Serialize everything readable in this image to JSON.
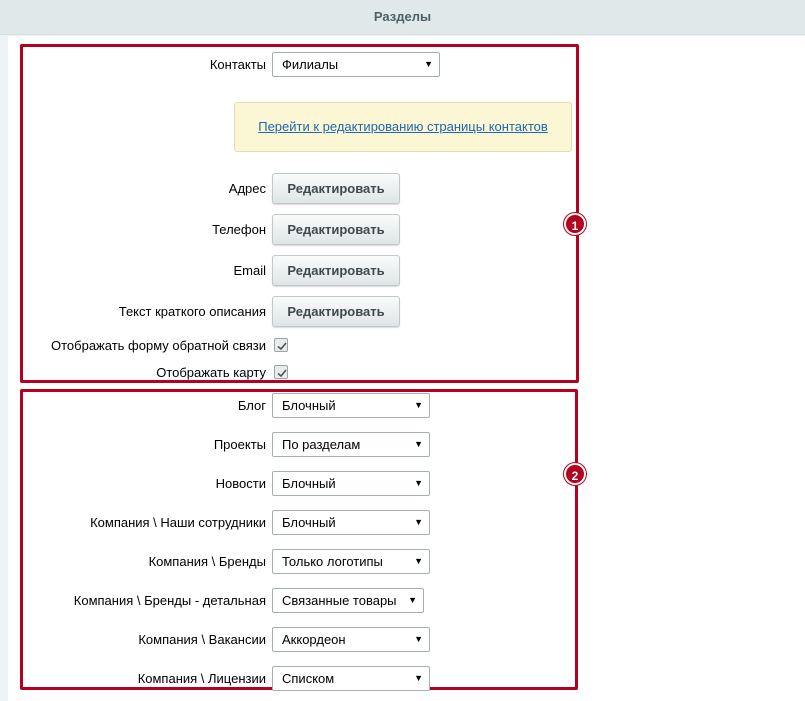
{
  "header": {
    "title": "Разделы"
  },
  "badges": {
    "one": "1",
    "two": "2"
  },
  "contacts": {
    "label": "Контакты",
    "value": "Филиалы",
    "notice_link": "Перейти к редактированию страницы контактов",
    "edit_label": "Редактировать",
    "address_label": "Адрес",
    "phone_label": "Телефон",
    "email_label": "Email",
    "description_label": "Текст краткого описания",
    "feedback_label": "Отображать форму обратной связи",
    "feedback_checked": true,
    "map_label": "Отображать карту",
    "map_checked": true
  },
  "sections": [
    {
      "label": "Блог",
      "value": "Блочный"
    },
    {
      "label": "Проекты",
      "value": "По разделам"
    },
    {
      "label": "Новости",
      "value": "Блочный"
    },
    {
      "label": "Компания \\ Наши сотрудники",
      "value": "Блочный"
    },
    {
      "label": "Компания \\ Бренды",
      "value": "Только логотипы"
    },
    {
      "label": "Компания \\ Бренды - детальная",
      "value": "Связанные товары"
    },
    {
      "label": "Компания \\ Вакансии",
      "value": "Аккордеон"
    },
    {
      "label": "Компания \\ Лицензии",
      "value": "Списком"
    }
  ],
  "colors": {
    "accent": "#b5001e",
    "link": "#2067b0",
    "notice_bg": "#fbf7d5"
  },
  "icons": {
    "dropdown": "triangle-down-icon",
    "check": "checkmark-icon"
  }
}
